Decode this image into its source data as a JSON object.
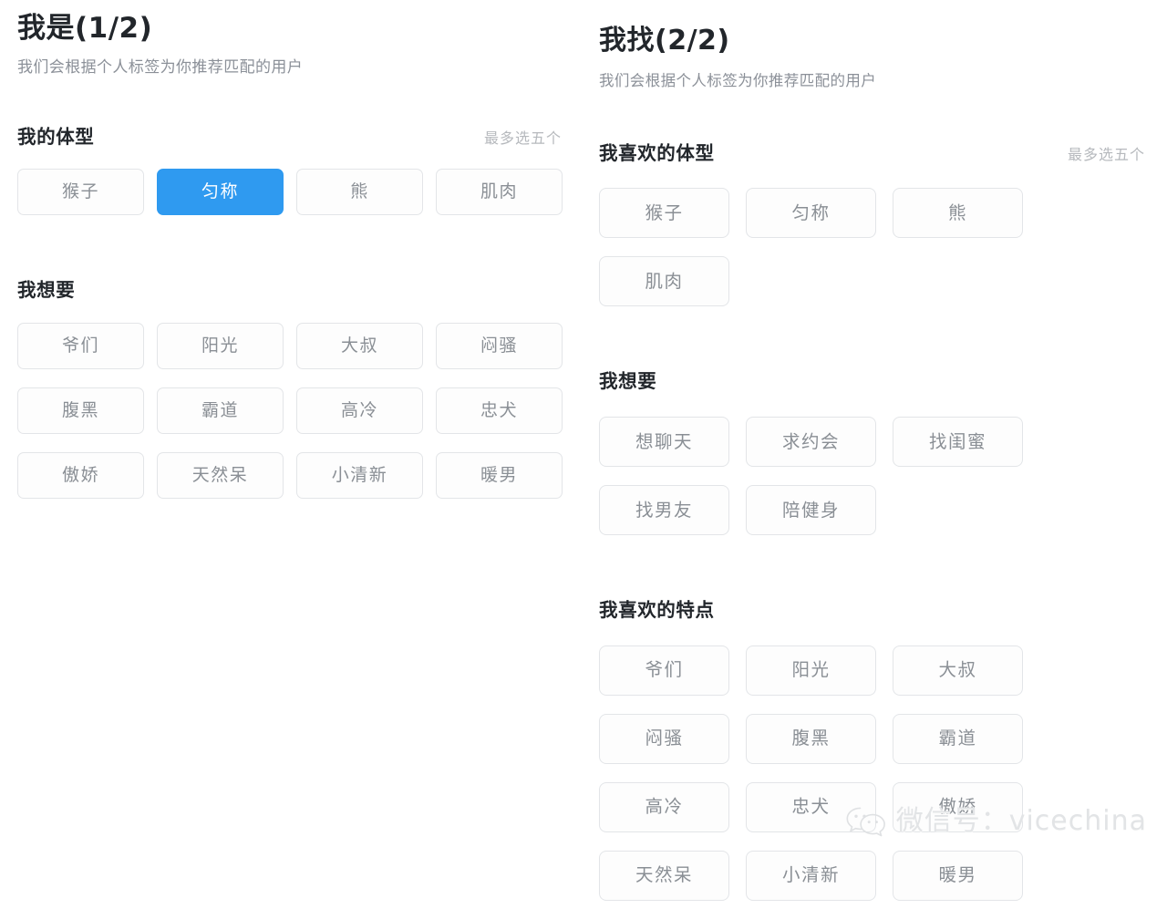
{
  "left_pane": {
    "title": "我是(1/2)",
    "subtitle": "我们会根据个人标签为你推荐匹配的用户",
    "sections": [
      {
        "title": "我的体型",
        "hint": "最多选五个",
        "tags": [
          {
            "label": "猴子",
            "selected": false
          },
          {
            "label": "匀称",
            "selected": true
          },
          {
            "label": "熊",
            "selected": false
          },
          {
            "label": "肌肉",
            "selected": false
          }
        ]
      },
      {
        "title": "我想要",
        "hint": "",
        "tags": [
          {
            "label": "爷们",
            "selected": false
          },
          {
            "label": "阳光",
            "selected": false
          },
          {
            "label": "大叔",
            "selected": false
          },
          {
            "label": "闷骚",
            "selected": false
          },
          {
            "label": "腹黑",
            "selected": false
          },
          {
            "label": "霸道",
            "selected": false
          },
          {
            "label": "高冷",
            "selected": false
          },
          {
            "label": "忠犬",
            "selected": false
          },
          {
            "label": "傲娇",
            "selected": false
          },
          {
            "label": "天然呆",
            "selected": false
          },
          {
            "label": "小清新",
            "selected": false
          },
          {
            "label": "暖男",
            "selected": false
          }
        ]
      }
    ]
  },
  "right_pane": {
    "title": "我找(2/2)",
    "subtitle": "我们会根据个人标签为你推荐匹配的用户",
    "sections": [
      {
        "title": "我喜欢的体型",
        "hint": "最多选五个",
        "tags": [
          {
            "label": "猴子",
            "selected": false
          },
          {
            "label": "匀称",
            "selected": false
          },
          {
            "label": "熊",
            "selected": false
          },
          {
            "label": "肌肉",
            "selected": false
          }
        ]
      },
      {
        "title": "我想要",
        "hint": "",
        "tags": [
          {
            "label": "想聊天",
            "selected": false
          },
          {
            "label": "求约会",
            "selected": false
          },
          {
            "label": "找闺蜜",
            "selected": false
          },
          {
            "label": "找男友",
            "selected": false
          },
          {
            "label": "陪健身",
            "selected": false
          }
        ]
      },
      {
        "title": "我喜欢的特点",
        "hint": "",
        "tags": [
          {
            "label": "爷们",
            "selected": false
          },
          {
            "label": "阳光",
            "selected": false
          },
          {
            "label": "大叔",
            "selected": false
          },
          {
            "label": "闷骚",
            "selected": false
          },
          {
            "label": "腹黑",
            "selected": false
          },
          {
            "label": "霸道",
            "selected": false
          },
          {
            "label": "高冷",
            "selected": false
          },
          {
            "label": "忠犬",
            "selected": false
          },
          {
            "label": "傲娇",
            "selected": false
          },
          {
            "label": "天然呆",
            "selected": false
          },
          {
            "label": "小清新",
            "selected": false
          },
          {
            "label": "暖男",
            "selected": false
          }
        ]
      }
    ]
  },
  "watermark": {
    "icon": "wechat-icon",
    "text": "微信号：vicechina"
  },
  "colors": {
    "accent_selected": "#2f9af0",
    "tag_border": "#e3e5e8",
    "tag_text": "#8a8f95",
    "title_text": "#22262b",
    "subtitle_text": "#8b9098",
    "hint_text": "#b6b9bd",
    "watermark_text": "#e2e4e6",
    "background": "#ffffff"
  }
}
